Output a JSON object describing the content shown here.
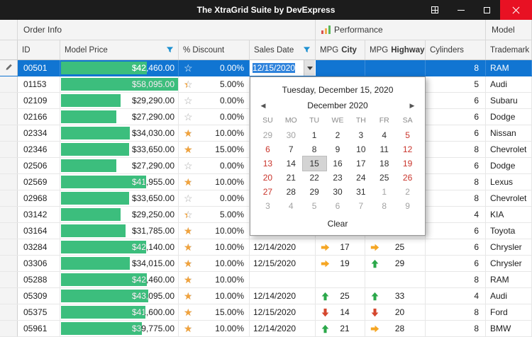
{
  "window": {
    "title": "The XtraGrid Suite by DevExpress"
  },
  "titlebar_buttons": [
    {
      "name": "layout-grid-icon"
    },
    {
      "name": "minimize-icon"
    },
    {
      "name": "maximize-icon"
    },
    {
      "name": "close-icon"
    }
  ],
  "bands": [
    {
      "label": "Order Info",
      "icon": ""
    },
    {
      "label": "Performance",
      "icon": "bar-chart-icon"
    },
    {
      "label": "Model",
      "icon": ""
    }
  ],
  "columns": [
    {
      "label": "ID",
      "filter": false
    },
    {
      "label": "Model Price",
      "filter": true
    },
    {
      "label": "% Discount",
      "filter": false
    },
    {
      "label": "Sales Date",
      "filter": true
    },
    {
      "label": "MPG",
      "label_bold": "City",
      "filter": false
    },
    {
      "label": "MPG",
      "label_bold": "Highway",
      "filter": false
    },
    {
      "label": "Cylinders",
      "filter": false
    },
    {
      "label": "Trademark",
      "filter": false
    }
  ],
  "price_scale_max": 58095,
  "colors": {
    "selection": "#1175d2",
    "bar": "#3cbe7d",
    "trend_up": "#2ba84a",
    "trend_flat": "#f5a623",
    "trend_down": "#d5472e",
    "star": "#f2a33c",
    "close_button": "#e81123",
    "filter_icon": "#1b8fd0"
  },
  "icons": {
    "star_empty": "☆",
    "star_filled": "★"
  },
  "rows": [
    {
      "id": "00501",
      "price": 42460,
      "price_text": "$42,460.00",
      "discount": "0.00%",
      "fill": 0,
      "date": "12/15/2020",
      "city": "",
      "city_trend": "",
      "hwy": "",
      "hwy_trend": "",
      "cyl": "8",
      "trademark": "RAM",
      "selected": true,
      "editing": true
    },
    {
      "id": "01153",
      "price": 58095,
      "price_text": "$58,095.00",
      "discount": "5.00%",
      "fill": 33,
      "date": "",
      "city": "",
      "city_trend": "",
      "hwy": "",
      "hwy_trend": "",
      "cyl": "5",
      "trademark": "Audi"
    },
    {
      "id": "02109",
      "price": 29290,
      "price_text": "$29,290.00",
      "discount": "0.00%",
      "fill": 0,
      "date": "",
      "city": "",
      "city_trend": "",
      "hwy": "",
      "hwy_trend": "",
      "cyl": "6",
      "trademark": "Subaru"
    },
    {
      "id": "02166",
      "price": 27290,
      "price_text": "$27,290.00",
      "discount": "0.00%",
      "fill": 0,
      "date": "",
      "city": "",
      "city_trend": "",
      "hwy": "",
      "hwy_trend": "",
      "cyl": "6",
      "trademark": "Dodge"
    },
    {
      "id": "02334",
      "price": 34030,
      "price_text": "$34,030.00",
      "discount": "10.00%",
      "fill": 66,
      "date": "",
      "city": "",
      "city_trend": "",
      "hwy": "",
      "hwy_trend": "",
      "cyl": "6",
      "trademark": "Nissan"
    },
    {
      "id": "02346",
      "price": 33650,
      "price_text": "$33,650.00",
      "discount": "15.00%",
      "fill": 100,
      "date": "",
      "city": "",
      "city_trend": "",
      "hwy": "",
      "hwy_trend": "",
      "cyl": "8",
      "trademark": "Chevrolet"
    },
    {
      "id": "02506",
      "price": 27290,
      "price_text": "$27,290.00",
      "discount": "0.00%",
      "fill": 0,
      "date": "",
      "city": "",
      "city_trend": "",
      "hwy": "",
      "hwy_trend": "",
      "cyl": "6",
      "trademark": "Dodge"
    },
    {
      "id": "02569",
      "price": 41955,
      "price_text": "$41,955.00",
      "discount": "10.00%",
      "fill": 66,
      "date": "",
      "city": "",
      "city_trend": "",
      "hwy": "",
      "hwy_trend": "",
      "cyl": "8",
      "trademark": "Lexus"
    },
    {
      "id": "02968",
      "price": 33650,
      "price_text": "$33,650.00",
      "discount": "0.00%",
      "fill": 0,
      "date": "",
      "city": "",
      "city_trend": "",
      "hwy": "",
      "hwy_trend": "",
      "cyl": "8",
      "trademark": "Chevrolet"
    },
    {
      "id": "03142",
      "price": 29250,
      "price_text": "$29,250.00",
      "discount": "5.00%",
      "fill": 33,
      "date": "",
      "city": "",
      "city_trend": "",
      "hwy": "",
      "hwy_trend": "",
      "cyl": "4",
      "trademark": "KIA"
    },
    {
      "id": "03164",
      "price": 31785,
      "price_text": "$31,785.00",
      "discount": "10.00%",
      "fill": 66,
      "date": "",
      "city": "",
      "city_trend": "",
      "hwy": "",
      "hwy_trend": "",
      "cyl": "6",
      "trademark": "Toyota"
    },
    {
      "id": "03284",
      "price": 42140,
      "price_text": "$42,140.00",
      "discount": "10.00%",
      "fill": 66,
      "date": "12/14/2020",
      "city": "17",
      "city_trend": "flat",
      "hwy": "25",
      "hwy_trend": "flat",
      "cyl": "6",
      "trademark": "Chrysler"
    },
    {
      "id": "03306",
      "price": 34015,
      "price_text": "$34,015.00",
      "discount": "10.00%",
      "fill": 66,
      "date": "12/15/2020",
      "city": "19",
      "city_trend": "flat",
      "hwy": "29",
      "hwy_trend": "up",
      "cyl": "6",
      "trademark": "Chrysler"
    },
    {
      "id": "05288",
      "price": 42460,
      "price_text": "$42,460.00",
      "discount": "10.00%",
      "fill": 66,
      "date": "",
      "city": "",
      "city_trend": "",
      "hwy": "",
      "hwy_trend": "",
      "cyl": "8",
      "trademark": "RAM"
    },
    {
      "id": "05309",
      "price": 43095,
      "price_text": "$43,095.00",
      "discount": "10.00%",
      "fill": 66,
      "date": "12/14/2020",
      "city": "25",
      "city_trend": "up",
      "hwy": "33",
      "hwy_trend": "up",
      "cyl": "4",
      "trademark": "Audi"
    },
    {
      "id": "05375",
      "price": 41600,
      "price_text": "$41,600.00",
      "discount": "15.00%",
      "fill": 100,
      "date": "12/15/2020",
      "city": "14",
      "city_trend": "down",
      "hwy": "20",
      "hwy_trend": "down",
      "cyl": "8",
      "trademark": "Ford"
    },
    {
      "id": "05961",
      "price": 39775,
      "price_text": "$39,775.00",
      "discount": "10.00%",
      "fill": 66,
      "date": "12/14/2020",
      "city": "21",
      "city_trend": "up",
      "hwy": "28",
      "hwy_trend": "flat",
      "cyl": "8",
      "trademark": "BMW"
    }
  ],
  "calendar": {
    "title": "Tuesday, December 15, 2020",
    "month_label": "December 2020",
    "prev_icon": "◀",
    "next_icon": "▶",
    "day_headers": [
      "SU",
      "MO",
      "TU",
      "WE",
      "TH",
      "FR",
      "SA"
    ],
    "weeks": [
      [
        {
          "t": "29",
          "s": "muted"
        },
        {
          "t": "30",
          "s": "muted"
        },
        {
          "t": "1"
        },
        {
          "t": "2"
        },
        {
          "t": "3"
        },
        {
          "t": "4"
        },
        {
          "t": "5",
          "s": "weekend"
        }
      ],
      [
        {
          "t": "6",
          "s": "weekend"
        },
        {
          "t": "7"
        },
        {
          "t": "8"
        },
        {
          "t": "9"
        },
        {
          "t": "10"
        },
        {
          "t": "11"
        },
        {
          "t": "12",
          "s": "weekend"
        }
      ],
      [
        {
          "t": "13",
          "s": "weekend"
        },
        {
          "t": "14"
        },
        {
          "t": "15",
          "s": "selected"
        },
        {
          "t": "16"
        },
        {
          "t": "17"
        },
        {
          "t": "18"
        },
        {
          "t": "19",
          "s": "weekend"
        }
      ],
      [
        {
          "t": "20",
          "s": "weekend"
        },
        {
          "t": "21"
        },
        {
          "t": "22"
        },
        {
          "t": "23"
        },
        {
          "t": "24"
        },
        {
          "t": "25"
        },
        {
          "t": "26",
          "s": "weekend"
        }
      ],
      [
        {
          "t": "27",
          "s": "weekend"
        },
        {
          "t": "28"
        },
        {
          "t": "29"
        },
        {
          "t": "30"
        },
        {
          "t": "31"
        },
        {
          "t": "1",
          "s": "muted"
        },
        {
          "t": "2",
          "s": "muted"
        }
      ],
      [
        {
          "t": "3",
          "s": "muted"
        },
        {
          "t": "4",
          "s": "muted"
        },
        {
          "t": "5",
          "s": "muted"
        },
        {
          "t": "6",
          "s": "muted"
        },
        {
          "t": "7",
          "s": "muted"
        },
        {
          "t": "8",
          "s": "muted"
        },
        {
          "t": "9",
          "s": "muted"
        }
      ]
    ],
    "clear_label": "Clear"
  }
}
